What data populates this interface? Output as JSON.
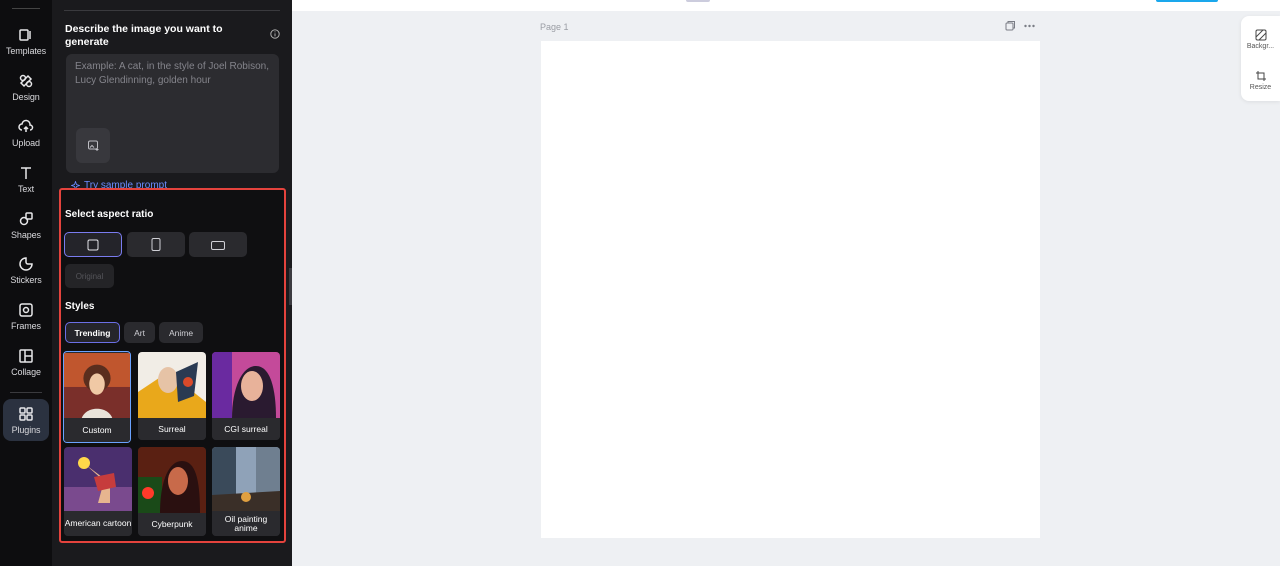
{
  "sidebar": {
    "items": [
      {
        "label": "Templates",
        "icon": "templates-icon"
      },
      {
        "label": "Design",
        "icon": "design-icon"
      },
      {
        "label": "Upload",
        "icon": "upload-icon"
      },
      {
        "label": "Text",
        "icon": "text-icon"
      },
      {
        "label": "Shapes",
        "icon": "shapes-icon"
      },
      {
        "label": "Stickers",
        "icon": "stickers-icon"
      },
      {
        "label": "Frames",
        "icon": "frames-icon"
      },
      {
        "label": "Collage",
        "icon": "collage-icon"
      },
      {
        "label": "Plugins",
        "icon": "plugins-icon",
        "active": true
      }
    ]
  },
  "panel": {
    "prompt_title": "Describe the image you want to generate",
    "prompt_placeholder": "Example: A cat, in the style of Joel Robison, Lucy Glendinning, golden hour",
    "prompt_value": "",
    "sample_prompt": "Try sample prompt",
    "aspect_title": "Select aspect ratio",
    "aspect_options": [
      "square",
      "portrait",
      "landscape"
    ],
    "aspect_selected": "square",
    "original_label": "Original",
    "styles_title": "Styles",
    "style_tabs": [
      {
        "label": "Trending",
        "active": true
      },
      {
        "label": "Art",
        "active": false
      },
      {
        "label": "Anime",
        "active": false
      }
    ],
    "styles": [
      {
        "name": "Custom",
        "selected": true
      },
      {
        "name": "Surreal",
        "selected": false
      },
      {
        "name": "CGI surreal",
        "selected": false
      },
      {
        "name": "American cartoon",
        "selected": false
      },
      {
        "name": "Cyberpunk",
        "selected": false
      },
      {
        "name": "Oil painting anime",
        "selected": false
      }
    ]
  },
  "canvas": {
    "page_label": "Page 1"
  },
  "right_dock": {
    "items": [
      {
        "label": "Backgr...",
        "icon": "background-icon"
      },
      {
        "label": "Resize",
        "icon": "resize-icon"
      }
    ]
  },
  "colors": {
    "accent": "#6b6fe6",
    "highlight_border": "#e4433d",
    "link": "#6b8cff",
    "topbar_button": "#1aa7ec"
  }
}
